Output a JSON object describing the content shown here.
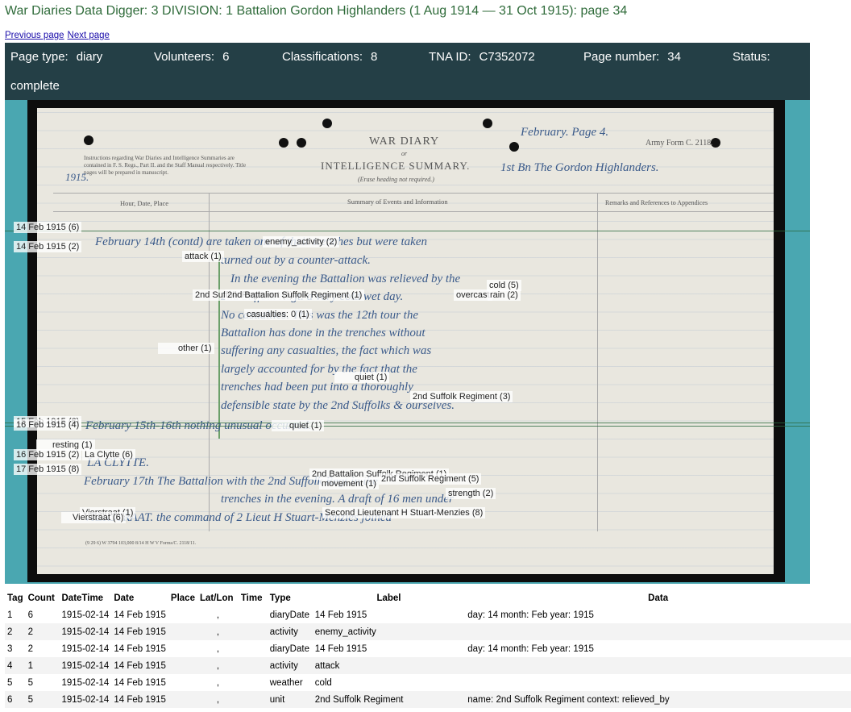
{
  "header": {
    "title_main": "War Diaries Data Digger: 3 DIVISION: 1 Battalion Gordon Highlanders",
    "title_sub": "(1 Aug 1914 — 31 Oct 1915): page 34"
  },
  "nav": {
    "previous": "Previous page",
    "next": "Next page"
  },
  "info": {
    "page_type_label": "Page type:",
    "page_type": "diary",
    "volunteers_label": "Volunteers:",
    "volunteers": "6",
    "classifications_label": "Classifications:",
    "classifications": "8",
    "tna_label": "TNA ID:",
    "tna": "C7352072",
    "page_number_label": "Page number:",
    "page_number": "34",
    "status_label": "Status:",
    "status": "complete"
  },
  "document": {
    "heading": "WAR DIARY",
    "or": "or",
    "heading2": "INTELLIGENCE SUMMARY.",
    "erase_note": "(Erase heading not required.)",
    "army_form": "Army Form C. 2118.",
    "instructions": "Instructions regarding War Diaries and Intelligence Summaries are contained in F. S. Regs., Part II. and the Staff Manual respectively. Title pages will be prepared in manuscript.",
    "col1": "Hour, Date, Place",
    "col2": "Summary of Events and Information",
    "col3": "Remarks and References to Appendices",
    "footer": "(9 29 6) W 3794 103,000 8/14 H W V Forms/C. 2118/11.",
    "hw": {
      "page_note": "February. Page 4.",
      "unit": "1st Bn The Gordon Highlanders.",
      "year": "1915.",
      "line1": "February 14th (contd) are taken one of their trenches but were taken",
      "line2": "turned out by a counter-attack.",
      "line3": "In the evening the Battalion was relieved by the",
      "line4": "2nd Suffolk Regt. a very cold wet day.",
      "line5": "No casualties. This was the 12th tour the",
      "line6": "Battalion has done in the trenches without",
      "line7": "suffering any casualties, the fact which was",
      "line8": "largely accounted for by the fact that the",
      "line9": "trenches had been put into a thoroughly",
      "line10": "defensible state by the 2nd Suffolks & ourselves.",
      "line11": "February 15th-16th nothing unusual occurred.",
      "line12": "LA CLYTTE.",
      "line13": "February 17th The Battalion with the 2nd Suffolk Regt in the",
      "line14": "trenches in the evening. A draft of 16 men under",
      "line15": "VIERSTRAAT. the command of 2 Lieut H Stuart-Menzies joined"
    }
  },
  "tags": [
    "14 Feb 1915 (6)",
    "14 Feb 1915 (2)",
    "enemy_activity (2)",
    "attack (1)",
    "cold (5)",
    "2nd Suffolk Regiment (5)",
    "2nd Battalion Suffolk Regiment (1)",
    "overcast",
    "rain (2)",
    "casualties: 0 (1)",
    "other (1)",
    "quiet (1)",
    "2nd Suffolk Regiment (3)",
    "15 Feb 1915 (6)",
    "16 Feb 1915 (4)",
    "quiet (1)",
    "resting (1)",
    "16 Feb 1915 (2)",
    "La Clytte (6)",
    "17 Feb 1915 (8)",
    "2nd Battalion Suffolk Regiment (1)",
    "2nd Suffolk Regiment (5)",
    "movement (1)",
    "strength (2)",
    "Vierstraat (1)",
    "Vierstraat (6)",
    "Second Lieutenant H Stuart-Menzies (8)"
  ],
  "table": {
    "headers": [
      "Tag",
      "Count",
      "DateTime",
      "Date",
      "Place",
      "Lat/Lon",
      "Time",
      "Type",
      "Label",
      "Data"
    ],
    "rows": [
      [
        "1",
        "6",
        "1915-02-14",
        "14 Feb 1915",
        "",
        ",",
        "",
        "diaryDate",
        "14 Feb 1915",
        "day: 14 month: Feb year: 1915"
      ],
      [
        "2",
        "2",
        "1915-02-14",
        "14 Feb 1915",
        "",
        ",",
        "",
        "activity",
        "enemy_activity",
        ""
      ],
      [
        "3",
        "2",
        "1915-02-14",
        "14 Feb 1915",
        "",
        ",",
        "",
        "diaryDate",
        "14 Feb 1915",
        "day: 14 month: Feb year: 1915"
      ],
      [
        "4",
        "1",
        "1915-02-14",
        "14 Feb 1915",
        "",
        ",",
        "",
        "activity",
        "attack",
        ""
      ],
      [
        "5",
        "5",
        "1915-02-14",
        "14 Feb 1915",
        "",
        ",",
        "",
        "weather",
        "cold",
        ""
      ],
      [
        "6",
        "5",
        "1915-02-14",
        "14 Feb 1915",
        "",
        ",",
        "",
        "unit",
        "2nd Suffolk Regiment",
        "name: 2nd Suffolk Regiment context: relieved_by"
      ]
    ]
  }
}
